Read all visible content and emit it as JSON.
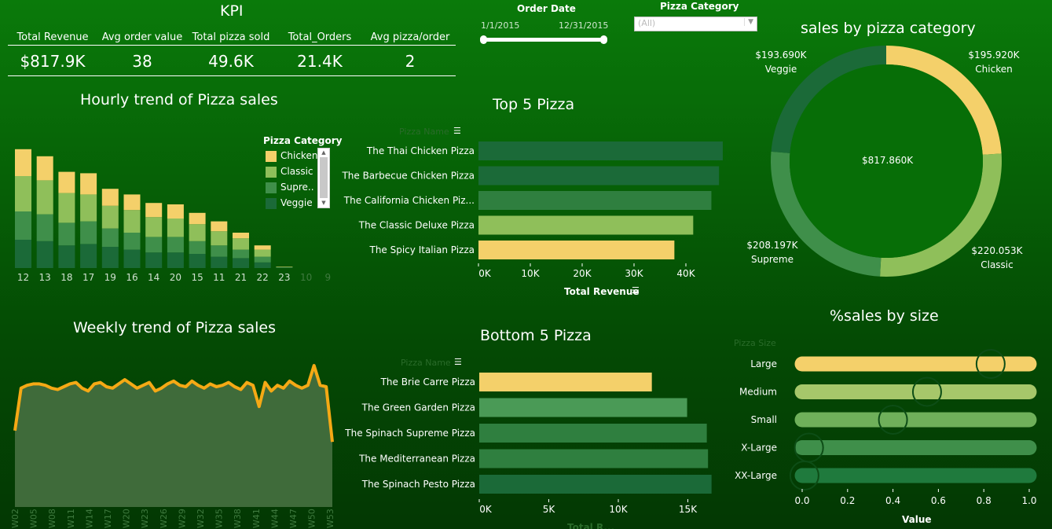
{
  "colors": {
    "chicken": "#f4d06a",
    "classic": "#8fbf5a",
    "supreme": "#3f8f4a",
    "veggie": "#1b6a38",
    "line": "#f5a915",
    "area": "#3f6b3a",
    "donut_center": "#076e07"
  },
  "kpi": {
    "title": "KPI",
    "headers": [
      "Total Revenue",
      "Avg order value",
      "Total pizza sold",
      "Total_Orders",
      "Avg pizza/order"
    ],
    "values": [
      "$817.9K",
      "38",
      "49.6K",
      "21.4K",
      "2"
    ]
  },
  "filters": {
    "order_date_label": "Order Date",
    "date_start": "1/1/2015",
    "date_end": "12/31/2015",
    "category_label": "Pizza Category",
    "category_value": "(All)"
  },
  "hourly": {
    "title": "Hourly trend of Pizza sales",
    "legend_title": "Pizza Category",
    "legend": [
      "Chicken",
      "Classic",
      "Supre..",
      "Veggie"
    ],
    "chart_data": {
      "type": "bar",
      "stacked": true,
      "categories": [
        "12",
        "13",
        "18",
        "17",
        "19",
        "16",
        "14",
        "20",
        "15",
        "11",
        "21",
        "22",
        "23",
        "10",
        "9"
      ],
      "series": [
        {
          "name": "Veggie",
          "values": [
            20,
            19,
            16,
            17,
            15,
            13,
            11,
            11,
            10,
            8,
            7,
            4,
            0.3,
            0,
            0
          ]
        },
        {
          "name": "Supre..",
          "values": [
            20,
            19,
            16,
            16,
            13,
            12,
            11,
            11,
            9,
            8,
            6,
            4,
            0.3,
            0,
            0
          ]
        },
        {
          "name": "Classic",
          "values": [
            25,
            24,
            21,
            19,
            16,
            16,
            14,
            13,
            12,
            10,
            8,
            5,
            0.2,
            0,
            0
          ]
        },
        {
          "name": "Chicken",
          "values": [
            19,
            17,
            15,
            15,
            12,
            11,
            10,
            10,
            8,
            7,
            4,
            3,
            0.2,
            0,
            0
          ]
        }
      ]
    }
  },
  "weekly": {
    "title": "Weekly trend of Pizza sales",
    "chart_data": {
      "type": "area",
      "categories": [
        "W02",
        "W05",
        "W08",
        "W11",
        "W14",
        "W17",
        "W20",
        "W23",
        "W26",
        "W29",
        "W32",
        "W35",
        "W38",
        "W41",
        "W44",
        "W47",
        "W50",
        "W53"
      ],
      "x": [
        1,
        2,
        3,
        4,
        5,
        6,
        7,
        8,
        9,
        10,
        11,
        12,
        13,
        14,
        15,
        16,
        17,
        18,
        19,
        20,
        21,
        22,
        23,
        24,
        25,
        26,
        27,
        28,
        29,
        30,
        31,
        32,
        33,
        34,
        35,
        36,
        37,
        38,
        39,
        40,
        41,
        42,
        43,
        44,
        45,
        46,
        47,
        48,
        49,
        50,
        51,
        52,
        53
      ],
      "values": [
        54,
        84,
        86,
        87,
        87,
        86,
        84,
        83,
        85,
        87,
        88,
        84,
        82,
        87,
        88,
        85,
        84,
        87,
        90,
        87,
        84,
        86,
        88,
        82,
        84,
        87,
        89,
        86,
        85,
        89,
        86,
        84,
        87,
        85,
        86,
        88,
        85,
        83,
        88,
        86,
        71,
        88,
        82,
        86,
        84,
        89,
        86,
        84,
        86,
        100,
        86,
        85,
        46
      ],
      "ylim": [
        0,
        110
      ]
    }
  },
  "top5": {
    "title": "Top 5 Pizza",
    "field_label": "Pizza Name",
    "axis_label": "Total Revenue",
    "chart_data": {
      "type": "bar",
      "orientation": "horizontal",
      "categories": [
        "The Thai Chicken Pizza",
        "The Barbecue Chicken Pizza",
        "The California Chicken Piz...",
        "The Classic Deluxe Pizza",
        "The Spicy Italian Pizza"
      ],
      "values": [
        43434,
        42768,
        41410,
        38180,
        34831
      ],
      "category_type": [
        "chicken",
        "chicken",
        "chicken",
        "classic",
        "chicken"
      ],
      "ticks": [
        "0K",
        "10K",
        "20K",
        "30K",
        "40K"
      ],
      "xlim": [
        0,
        44000
      ]
    }
  },
  "bottom5": {
    "title": "Bottom 5 Pizza",
    "field_label": "Pizza Name",
    "axis_label": "Total R...",
    "chart_data": {
      "type": "bar",
      "orientation": "horizontal",
      "categories": [
        "The Brie Carre Pizza",
        "The Green Garden Pizza",
        "The Spinach Supreme Pizza",
        "The Mediterranean Pizza",
        "The Spinach Pesto Pizza"
      ],
      "values": [
        11588,
        13956,
        15278,
        15360,
        15596
      ],
      "category_type": [
        "chicken",
        "supreme",
        "supreme",
        "supreme",
        "veggie"
      ],
      "ticks": [
        "0K",
        "5K",
        "10K",
        "15K"
      ],
      "xlim": [
        0,
        16300
      ]
    }
  },
  "category_sales": {
    "title": "sales by pizza category",
    "center_label": "$817.860K",
    "chart_data": {
      "type": "pie",
      "donut": true,
      "categories": [
        "Chicken",
        "Classic",
        "Supreme",
        "Veggie"
      ],
      "values": [
        195.92,
        220.053,
        208.197,
        193.69
      ],
      "labels": [
        "$195.920K",
        "$220.053K",
        "$208.197K",
        "$193.690K"
      ]
    }
  },
  "size_sales": {
    "title": "%sales by size",
    "field_label": "Pizza Size",
    "axis_label": "Value",
    "chart_data": {
      "type": "scatter",
      "categories": [
        "Large",
        "Medium",
        "Small",
        "X-Large",
        "XX-Large"
      ],
      "values": [
        0.83,
        0.55,
        0.4,
        0.03,
        0.01
      ],
      "ticks": [
        "0.0",
        "0.2",
        "0.4",
        "0.6",
        "0.8",
        "1.0"
      ],
      "xlim": [
        0,
        1
      ]
    }
  }
}
